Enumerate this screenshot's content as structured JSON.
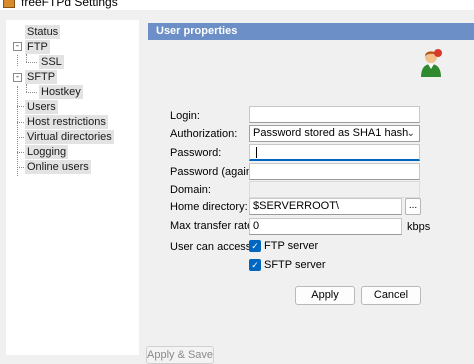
{
  "window": {
    "title": "freeFTPd Settings"
  },
  "tree": {
    "items": [
      {
        "label": "Status"
      },
      {
        "label": "FTP"
      },
      {
        "label": "SSL"
      },
      {
        "label": "SFTP"
      },
      {
        "label": "Hostkey"
      },
      {
        "label": "Users"
      },
      {
        "label": "Host restrictions"
      },
      {
        "label": "Virtual directories"
      },
      {
        "label": "Logging"
      },
      {
        "label": "Online users"
      }
    ]
  },
  "panel": {
    "header": "User properties",
    "fields": {
      "login": {
        "label": "Login:",
        "value": ""
      },
      "authorization": {
        "label": "Authorization:",
        "value": "Password stored as SHA1 hash"
      },
      "password": {
        "label": "Password:",
        "value": ""
      },
      "password_again": {
        "label": "Password (again):",
        "value": ""
      },
      "domain": {
        "label": "Domain:",
        "value": ""
      },
      "home_directory": {
        "label": "Home directory:",
        "value": "$SERVERROOT\\",
        "browse_label": "..."
      },
      "max_transfer_rate": {
        "label": "Max transfer rate:",
        "value": "0",
        "unit": "kbps"
      }
    },
    "access": {
      "label": "User can access:",
      "ftp": {
        "label": "FTP server",
        "checked": true
      },
      "sftp": {
        "label": "SFTP server",
        "checked": true
      }
    },
    "buttons": {
      "apply": "Apply",
      "cancel": "Cancel"
    }
  },
  "footer": {
    "apply_save": "Apply & Save"
  },
  "colors": {
    "header_bg": "#6b8fc6",
    "checkbox_accent": "#0067c0"
  },
  "icons": {
    "app": "freeftpd-app-icon",
    "user": "user-add-icon",
    "expander": "tree-expander-icon",
    "chevron": "chevron-down-icon",
    "check": "checkmark-icon"
  }
}
